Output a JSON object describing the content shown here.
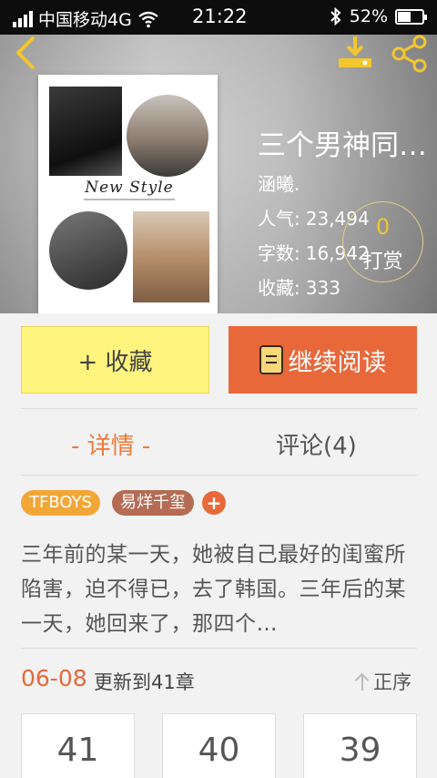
{
  "status_bar": {
    "carrier": "中国移动4G",
    "time": "21:22",
    "battery": "52%",
    "battery_fraction": 0.52
  },
  "header": {
    "cover_title": "New Style",
    "book_title": "三个男神同…",
    "author": "涵曦.",
    "stats": [
      {
        "label": "人气:",
        "value": "23,494"
      },
      {
        "label": "字数:",
        "value": "16,942"
      },
      {
        "label": "收藏:",
        "value": "333"
      }
    ],
    "tip": {
      "count": "0",
      "label": "打赏"
    }
  },
  "actions": {
    "favorite_label": "+ 收藏",
    "read_label": "继续阅读"
  },
  "tabs": [
    {
      "label": "- 详情 -",
      "active": true
    },
    {
      "label": "评论(4)",
      "active": false
    }
  ],
  "tags": [
    "TFBOYS",
    "易烊千玺"
  ],
  "tag_add_label": "+",
  "synopsis": "三年前的某一天，她被自己最好的闺蜜所陷害，迫不得已，去了韩国。三年后的某一天，她回来了，那四个…",
  "chapters": {
    "update_date": "06-08",
    "update_text": "更新到41章",
    "sort_label": "正序",
    "items": [
      "41",
      "40",
      "39"
    ]
  },
  "colors": {
    "accent": "#e8683a",
    "favorite_bg": "#fff47d",
    "tag_tfboys": "#f2a636",
    "tag_yiyang": "#b56b54",
    "tab_active": "#ee7a3c"
  }
}
